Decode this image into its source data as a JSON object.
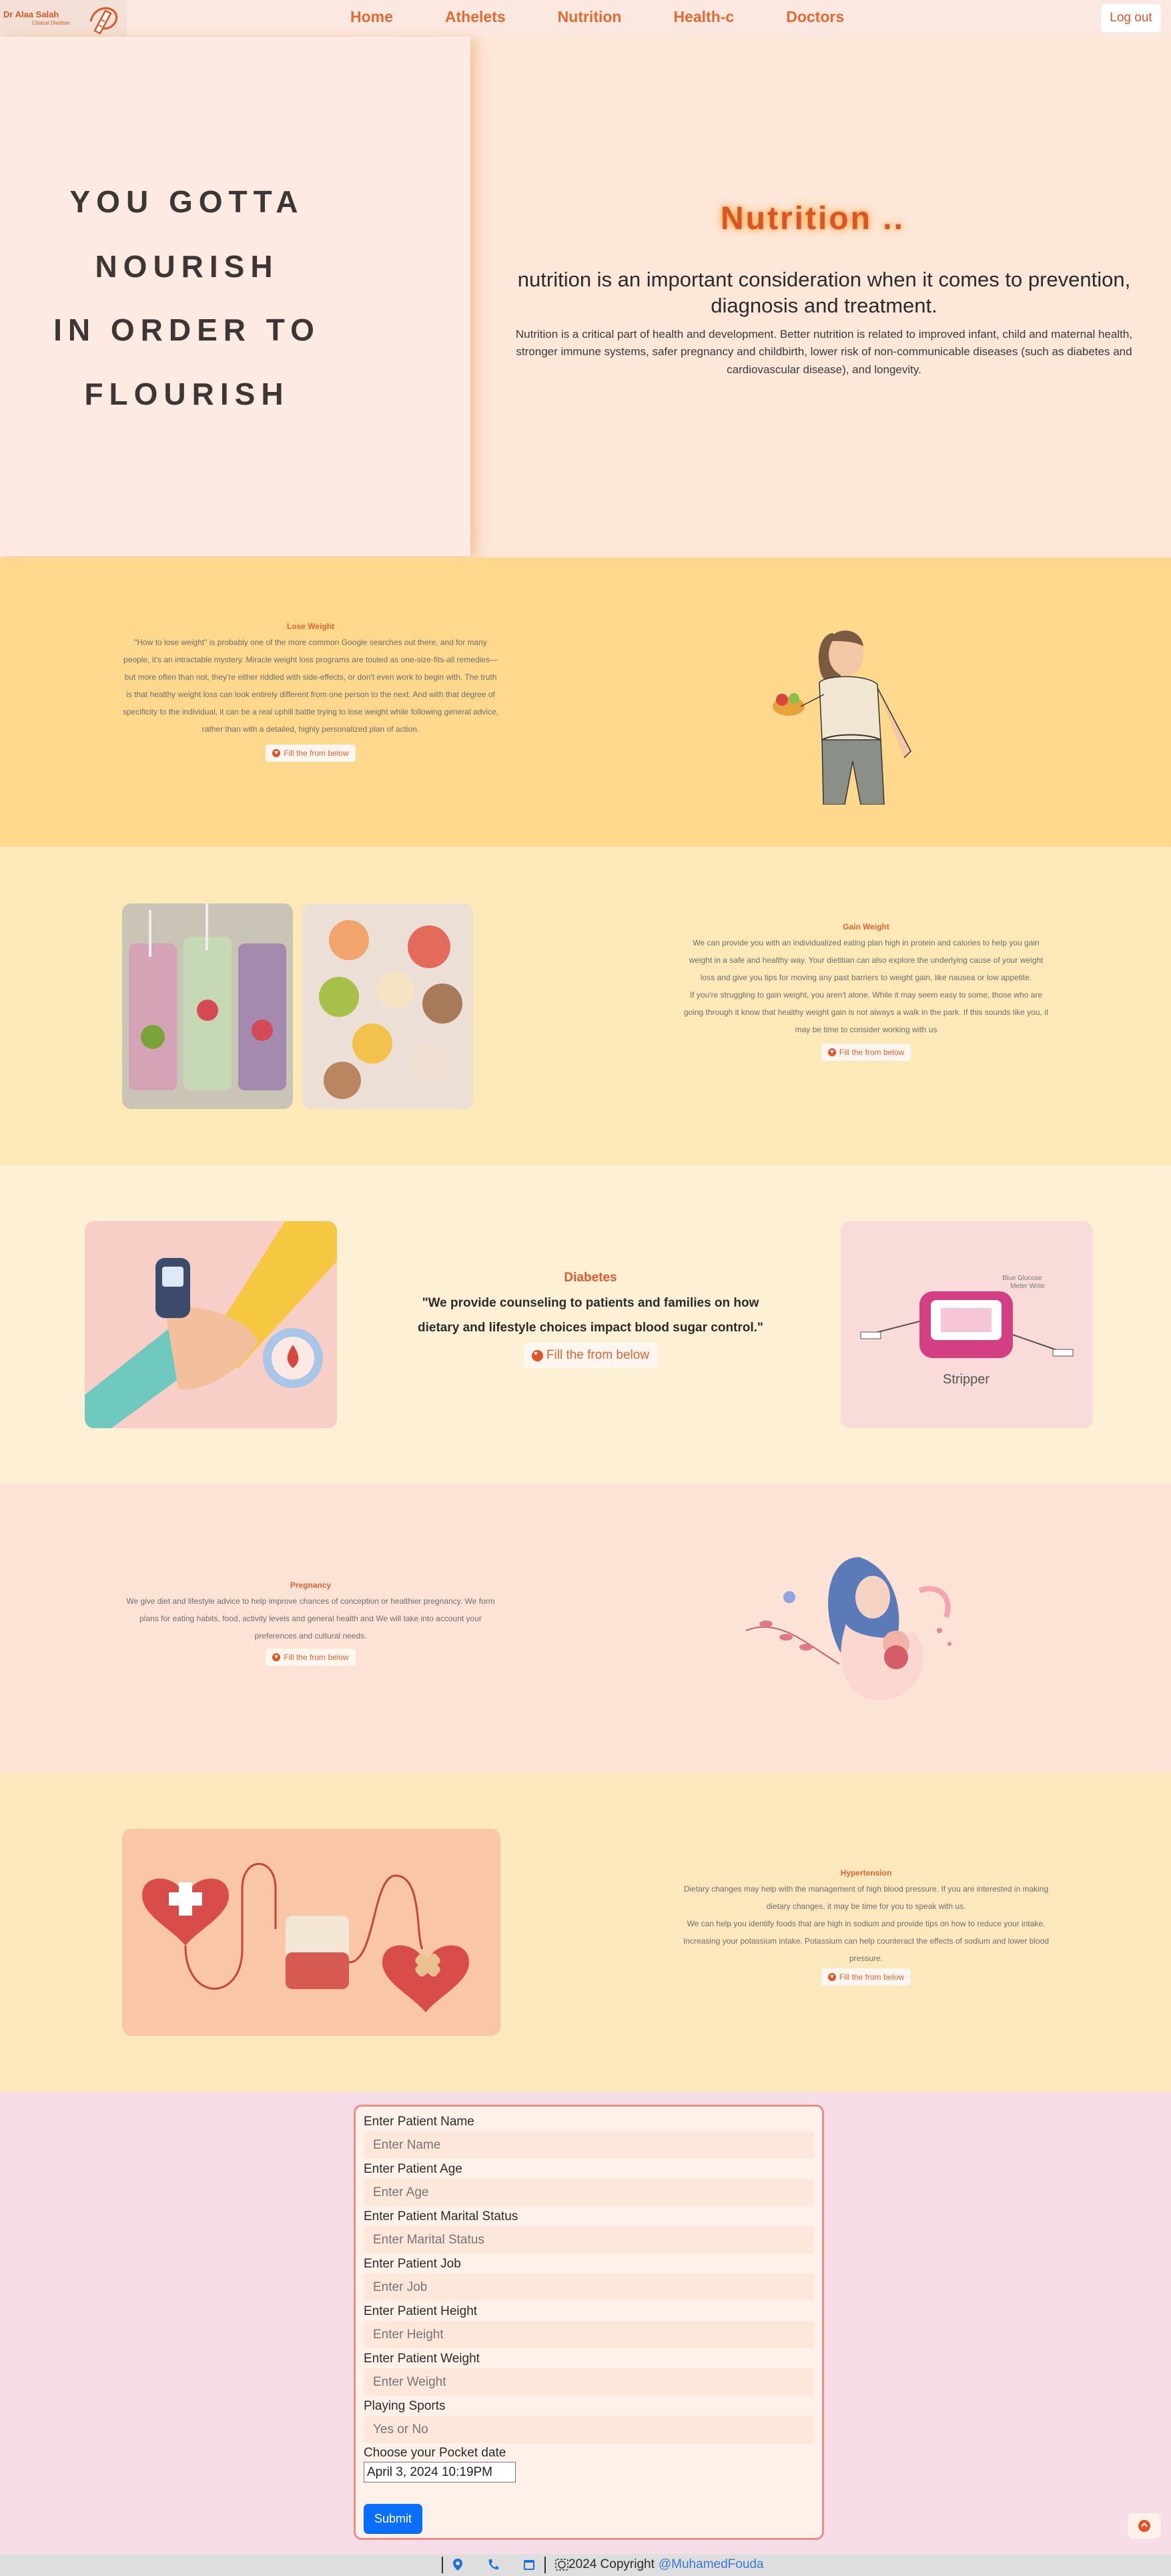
{
  "nav": {
    "logo_title": "Dr Alaa Salah",
    "logo_subtitle": "Clinical Dietitian",
    "links": [
      "Home",
      "Athelets",
      "Nutrition",
      "Health-c",
      "Doctors"
    ],
    "logout": "Log out"
  },
  "hero": {
    "quote_lines": [
      "YOU GOTTA",
      "NOURISH",
      "IN ORDER TO",
      "FLOURISH"
    ],
    "title": "Nutrition ..",
    "lead": "nutrition is an important consideration when it comes to prevention, diagnosis and treatment.",
    "body": "Nutrition is a critical part of health and development. Better nutrition is related to improved infant, child and maternal health, stronger immune systems, safer pregnancy and childbirth, lower risk of non-communicable diseases (such as diabetes and cardiovascular disease), and longevity."
  },
  "sections": {
    "lose_weight": {
      "title": "Lose Weight",
      "text": "\"How to lose weight\" is probably one of the more common Google searches out there, and for many people, it's an intractable mystery. Miracle weight loss programs are touted as one-size-fits-all remedies—but more often than not, they're either riddled with side-effects, or don't even work to begin with. The truth is that healthy weight loss can look entirely different from one person to the next. And with that degree of specificity to the individual, it can be a real uphill battle trying to lose weight while following general advice, rather than with a detailed, highly personalized plan of action.",
      "button": "Fill the from below"
    },
    "gain_weight": {
      "title": "Gain Weight",
      "text": "We can provide you with an individualized eating plan high in protein and calories to help you gain weight in a safe and healthy way. Your dietitian can also explore the underlying cause of your weight loss and give you tips for moving any past barriers to weight gain, like nausea or low appetite.",
      "text2": "If you're struggling to gain weight, you aren't alone. While it may seem easy to some, those who are going through it know that healthy weight gain is not always a walk in the park. If this sounds like you, it may be time to consider working with us",
      "button": "Fill the from below"
    },
    "diabetes": {
      "title": "Diabetes",
      "text": "\"We provide counseling to patients and families on how dietary and lifestyle choices impact blood sugar control.\"",
      "button": "Fill the from below",
      "image_text_brand": "Stripper",
      "image_text_top": "Blue Glucose\nMeter Write"
    },
    "pregnancy": {
      "title": "Pregnancy",
      "text": "We give diet and lifestyle advice to help improve chances of conception or healthier pregnancy. We form plans for eating habits, food, activity levels and general health and We will take into account your preferences and cultural needs.",
      "button": "Fill the from below"
    },
    "hypertension": {
      "title": "Hypertension",
      "text": "Dietary changes may help with the management of high blood pressure. If you are interested in making dietary changes, it may be time for you to speak with us.",
      "text2": "We can help you identify foods that are high in sodium and provide tips on how to reduce your intake. Increasing your potassium intake. Potassium can help counteract the effects of sodium and lower blood pressure.",
      "button": "Fill the from below"
    }
  },
  "form": {
    "fields": [
      {
        "label": "Enter Patient Name",
        "placeholder": "Enter Name"
      },
      {
        "label": "Enter Patient Age",
        "placeholder": "Enter Age"
      },
      {
        "label": "Enter Patient Marital Status",
        "placeholder": "Enter Marital Status"
      },
      {
        "label": "Enter Patient Job",
        "placeholder": "Enter Job"
      },
      {
        "label": "Enter Patient Height",
        "placeholder": "Enter Height"
      },
      {
        "label": "Enter Patient Weight",
        "placeholder": "Enter Weight"
      },
      {
        "label": "Playing Sports",
        "placeholder": "Yes or No"
      }
    ],
    "date_label": "Choose your Pocket date",
    "date_value": "April 3, 2024 10:19PM",
    "submit": "Submit"
  },
  "footer": {
    "copyright": "2024 Copyright",
    "author": "@MuhamedFouda"
  },
  "colors": {
    "accent": "#e16532",
    "button_blue": "#0a6efd",
    "lose_bg": "#fdd88d",
    "gain_bg": "#fde9b8",
    "diabetes_bg": "#fdf0d4",
    "pregnancy_bg": "#fde2d6",
    "hypertension_bg": "#fde8be",
    "form_bg": "#f7dde8"
  }
}
